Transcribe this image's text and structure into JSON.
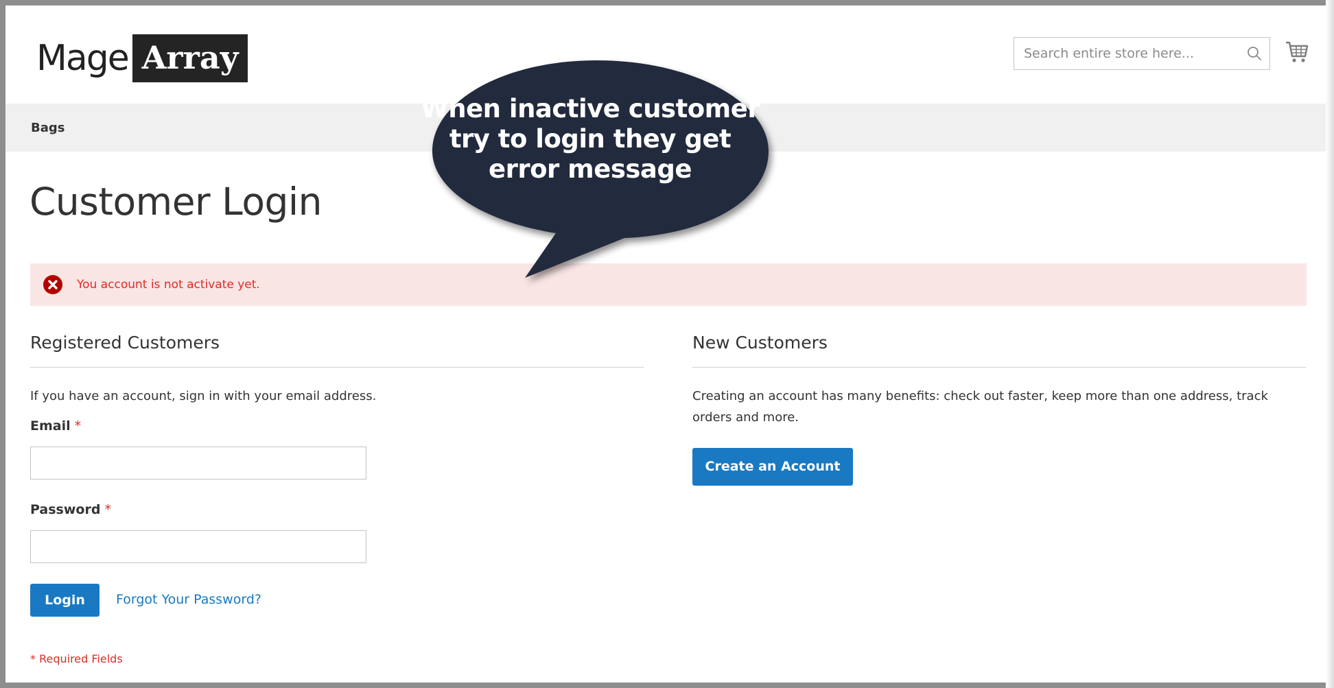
{
  "header": {
    "logo_part1": "Mage",
    "logo_part2": "Array",
    "search_placeholder": "Search entire store here...",
    "search_icon": "magnifier-icon",
    "cart_icon": "shopping-cart-icon"
  },
  "breadcrumb": {
    "current": "Bags"
  },
  "page": {
    "title": "Customer Login"
  },
  "error": {
    "icon": "error-x-circle-icon",
    "message": "You account is not activate yet."
  },
  "callout": {
    "line1": "When inactive customer",
    "line2": "try to login they get",
    "line3": "error message"
  },
  "registered": {
    "title": "Registered Customers",
    "intro": "If you have an account, sign in with your email address.",
    "email_label": "Email",
    "password_label": "Password",
    "required_marker": "*",
    "email_value": "",
    "password_value": "",
    "login_button": "Login",
    "forgot_link": "Forgot Your Password?",
    "required_note": "* Required Fields"
  },
  "new_customers": {
    "title": "New Customers",
    "intro": "Creating an account has many benefits: check out faster, keep more than one address, track orders and more.",
    "create_button": "Create an Account"
  },
  "colors": {
    "primary_button": "#1979c3",
    "error_text": "#e02b27",
    "error_background": "#fae5e5",
    "callout_fill": "#232b3d",
    "band_background": "#f0f0f0"
  }
}
